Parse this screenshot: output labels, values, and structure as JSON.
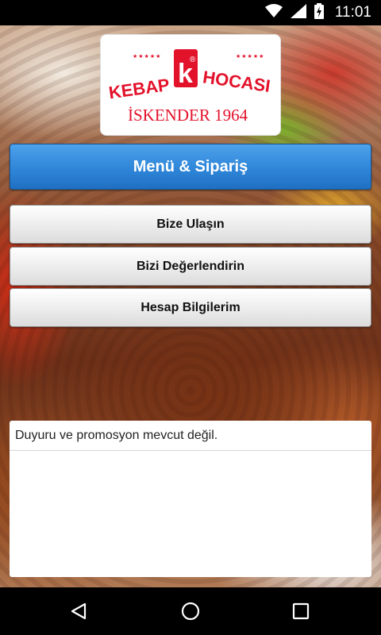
{
  "status_bar": {
    "time": "11:01",
    "icons": [
      "wifi-icon",
      "cell-signal-icon",
      "battery-charging-icon"
    ]
  },
  "logo": {
    "word_left": "KEBAP",
    "word_right": "HOCASI",
    "letter": "k",
    "registered": "®",
    "tagline": "İSKENDER 1964",
    "stars": "★★★★★",
    "brand_color": "#e3122b"
  },
  "menu": {
    "primary_label": "Menü & Sipariş",
    "contact_label": "Bize Ulaşın",
    "rate_label": "Bizi Değerlendirin",
    "account_label": "Hesap Bilgilerim"
  },
  "announcements": {
    "message": "Duyuru ve promosyon mevcut değil."
  },
  "nav_bar": {
    "icons": [
      "back-icon",
      "home-icon",
      "recents-icon"
    ]
  },
  "colors": {
    "primary_button": "#2f86d8",
    "secondary_button": "#e6e6e6"
  }
}
